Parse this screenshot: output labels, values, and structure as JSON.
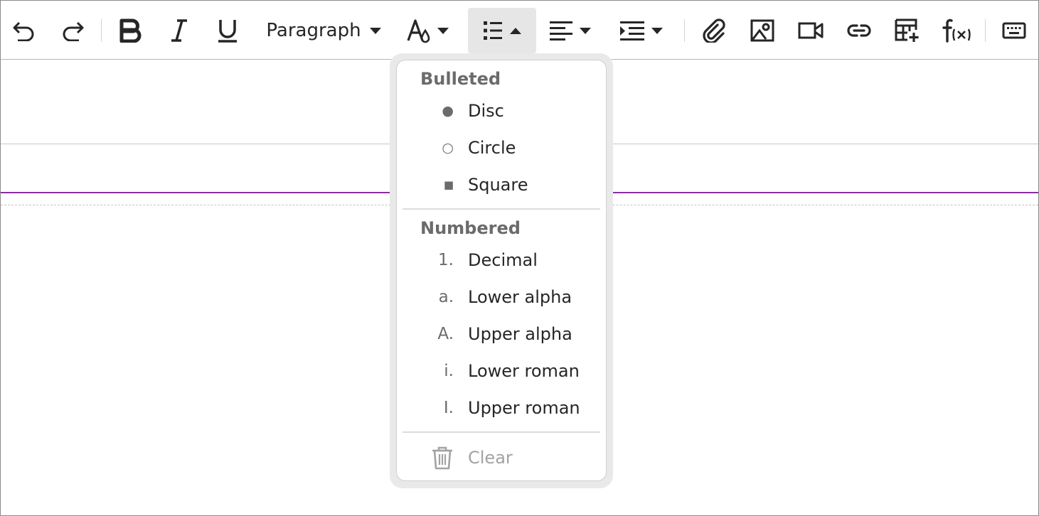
{
  "toolbar": {
    "undo": "undo-icon",
    "redo": "redo-icon",
    "bold": "bold-icon",
    "italic": "italic-icon",
    "underline": "underline-icon",
    "paragraph_label": "Paragraph",
    "text_color": "text-color-icon",
    "list": "list-icon",
    "align": "align-icon",
    "indent": "indent-icon",
    "attach": "paperclip-icon",
    "image": "image-icon",
    "video": "video-icon",
    "link": "link-icon",
    "table": "table-icon",
    "formula": "formula-icon",
    "keyboard": "keyboard-icon"
  },
  "list_menu": {
    "bulleted_title": "Bulleted",
    "bulleted": [
      {
        "marker": "●",
        "label": "Disc"
      },
      {
        "marker": "○",
        "label": "Circle"
      },
      {
        "marker": "■",
        "label": "Square"
      }
    ],
    "numbered_title": "Numbered",
    "numbered": [
      {
        "marker": "1.",
        "label": "Decimal"
      },
      {
        "marker": "a.",
        "label": "Lower alpha"
      },
      {
        "marker": "A.",
        "label": "Upper alpha"
      },
      {
        "marker": "i.",
        "label": "Lower roman"
      },
      {
        "marker": "I.",
        "label": "Upper roman"
      }
    ],
    "clear_label": "Clear"
  },
  "colors": {
    "accent_line": "#8c2d9e",
    "active_button_bg": "#e6e6e6"
  }
}
